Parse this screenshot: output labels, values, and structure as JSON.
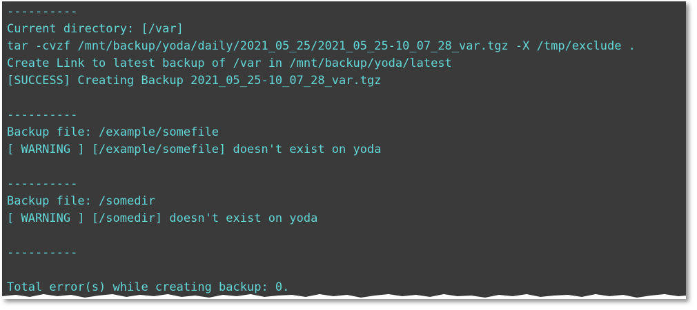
{
  "terminal": {
    "text_color": "#63d7d7",
    "background_color": "#3a3a3a",
    "lines": [
      "----------",
      "Current directory: [/var]",
      "tar -cvzf /mnt/backup/yoda/daily/2021_05_25/2021_05_25-10_07_28_var.tgz -X /tmp/exclude .",
      "Create Link to latest backup of /var in /mnt/backup/yoda/latest",
      "[SUCCESS] Creating Backup 2021_05_25-10_07_28_var.tgz",
      "",
      "----------",
      "Backup file: /example/somefile",
      "[ WARNING ] [/example/somefile] doesn't exist on yoda",
      "",
      "----------",
      "Backup file: /somedir",
      "[ WARNING ] [/somedir] doesn't exist on yoda",
      "",
      "----------",
      "",
      "Total error(s) while creating backup: 0."
    ]
  }
}
